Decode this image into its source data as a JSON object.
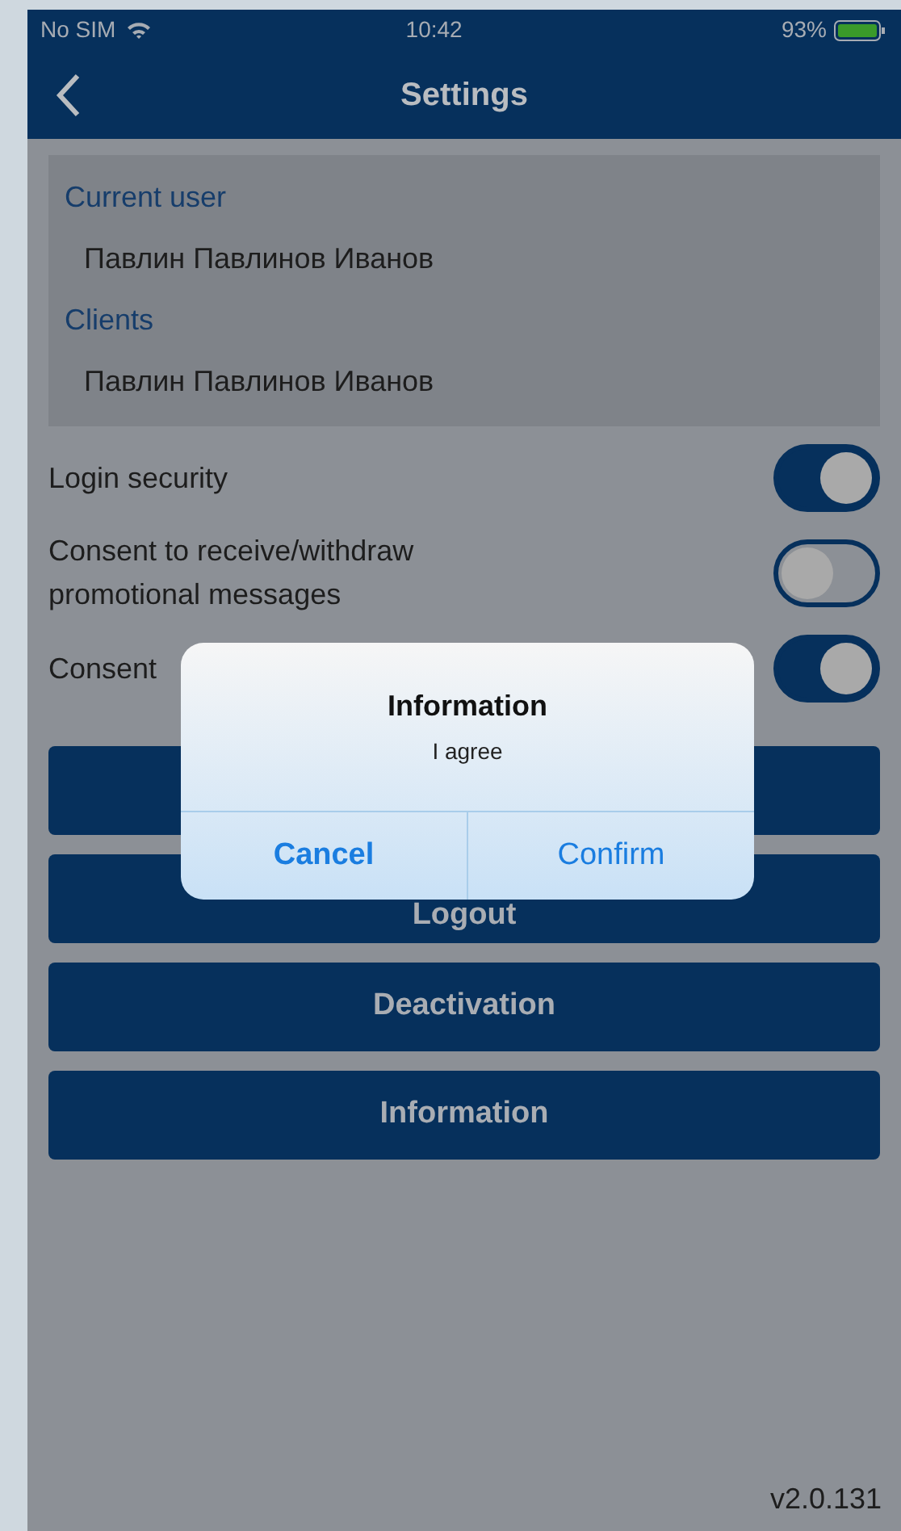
{
  "status_bar": {
    "carrier": "No SIM",
    "time": "10:42",
    "battery": "93%"
  },
  "nav": {
    "title": "Settings"
  },
  "user_card": {
    "sections": [
      {
        "heading": "Current user",
        "value": "Павлин Павлинов Иванов"
      },
      {
        "heading": "Clients",
        "value": "Павлин Павлинов Иванов"
      }
    ]
  },
  "toggles": [
    {
      "label": "Login security",
      "on": true
    },
    {
      "label": "Consent to receive/withdraw promotional messages",
      "on": false
    },
    {
      "label": "Consent",
      "on": true
    }
  ],
  "buttons": [
    {
      "kind": "covered"
    },
    {
      "kind": "partly_covered",
      "label": "Logout"
    },
    {
      "kind": "plain",
      "label": "Deactivation"
    },
    {
      "kind": "plain",
      "label": "Information"
    }
  ],
  "version": "v2.0.131",
  "dialog": {
    "title": "Information",
    "message": "I agree",
    "actions": [
      {
        "label": "Cancel",
        "bold": true
      },
      {
        "label": "Confirm",
        "bold": false
      }
    ]
  }
}
